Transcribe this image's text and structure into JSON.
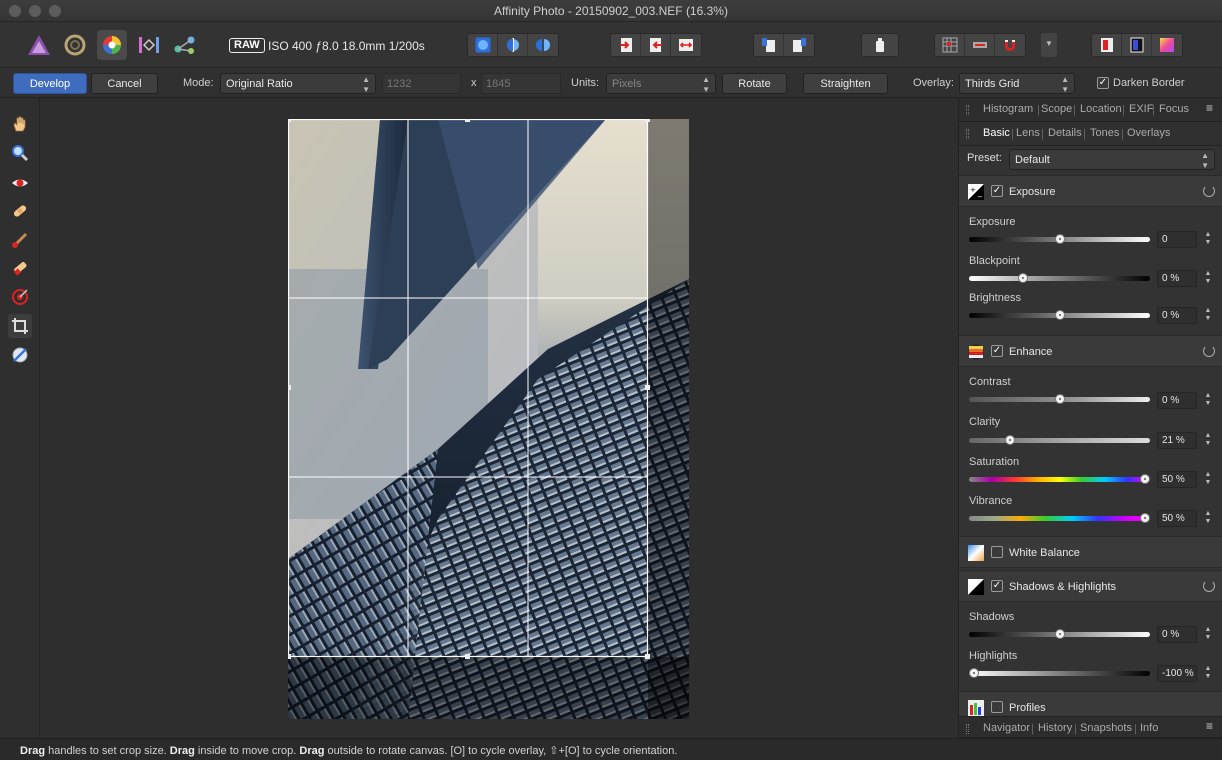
{
  "window": {
    "title": "Affinity Photo - 20150902_003.NEF (16.3%)"
  },
  "toolbar": {
    "personas": [
      "photo-persona-icon",
      "liquify-persona-icon",
      "develop-persona-icon",
      "tone-mapping-persona-icon",
      "export-persona-icon"
    ],
    "raw_badge": "RAW",
    "exif": "ISO 400 ƒ8.0 18.0mm 1/200s"
  },
  "context": {
    "develop_label": "Develop",
    "cancel_label": "Cancel",
    "mode_label": "Mode:",
    "mode_value": "Original Ratio",
    "width_value": "1232",
    "x_label": "x",
    "height_value": "1845",
    "units_label": "Units:",
    "units_value": "Pixels",
    "rotate_label": "Rotate",
    "straighten_label": "Straighten",
    "overlay_label": "Overlay:",
    "overlay_value": "Thirds Grid",
    "darken_label": "Darken Border",
    "darken_checked": true
  },
  "panel": {
    "top_tabs": [
      "Histogram",
      "Scope",
      "Location",
      "EXIF",
      "Focus"
    ],
    "tabs": [
      "Basic",
      "Lens",
      "Details",
      "Tones",
      "Overlays"
    ],
    "active_tab": "Basic",
    "preset_label": "Preset:",
    "preset_value": "Default",
    "sections": {
      "exposure": {
        "title": "Exposure",
        "enabled": true,
        "sliders": [
          {
            "label": "Exposure",
            "value": "0",
            "position": 0.5
          },
          {
            "label": "Blackpoint",
            "value": "0 %",
            "position": 0.3
          },
          {
            "label": "Brightness",
            "value": "0 %",
            "position": 0.5
          }
        ]
      },
      "enhance": {
        "title": "Enhance",
        "enabled": true,
        "sliders": [
          {
            "label": "Contrast",
            "value": "0 %",
            "position": 0.5
          },
          {
            "label": "Clarity",
            "value": "21 %",
            "position": 0.22
          },
          {
            "label": "Saturation",
            "value": "50 %",
            "position": 0.97
          },
          {
            "label": "Vibrance",
            "value": "50 %",
            "position": 0.97
          }
        ]
      },
      "white_balance": {
        "title": "White Balance",
        "enabled": false
      },
      "shadows_highlights": {
        "title": "Shadows & Highlights",
        "enabled": true,
        "sliders": [
          {
            "label": "Shadows",
            "value": "0 %",
            "position": 0.5
          },
          {
            "label": "Highlights",
            "value": "-100 %",
            "position": 0.0
          }
        ]
      },
      "profiles": {
        "title": "Profiles",
        "enabled": false
      }
    },
    "bottom_tabs": [
      "Navigator",
      "History",
      "Snapshots",
      "Info"
    ]
  },
  "status": {
    "drag1": "Drag",
    "text1": " handles to set crop size. ",
    "drag2": "Drag",
    "text2": " inside to move crop. ",
    "drag3": "Drag",
    "text3": " outside to rotate canvas. [O] to cycle overlay, ⇧+[O] to cycle orientation."
  },
  "colors": {
    "accent": "#3f6cbf",
    "panel_bg": "#333333",
    "canvas_bg": "#2e2e2e"
  }
}
